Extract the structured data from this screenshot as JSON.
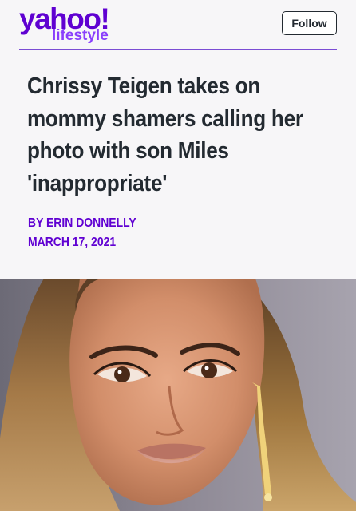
{
  "header": {
    "logo": {
      "brand": "yahoo!",
      "section": "lifestyle",
      "brand_color": "#5f01d1",
      "section_color": "#8a3ffc"
    },
    "follow_label": "Follow"
  },
  "article": {
    "headline": "Chrissy Teigen takes on mommy shamers calling her photo with son Miles 'inappropriate'",
    "byline": "BY ERIN DONNELLY",
    "date": "MARCH 17, 2021",
    "accent_color": "#6001d2",
    "hero_image": {
      "icon": "portrait-photo"
    }
  }
}
